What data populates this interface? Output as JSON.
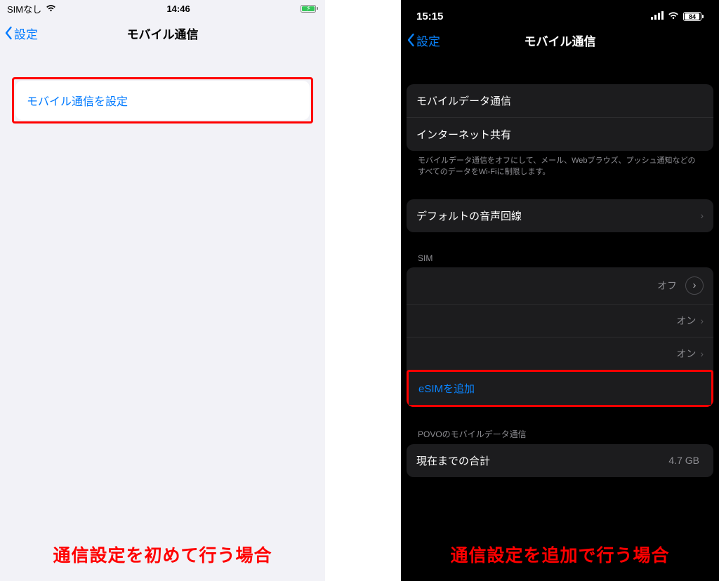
{
  "left": {
    "status": {
      "sim_text": "SIMなし",
      "time": "14:46"
    },
    "nav": {
      "back_label": "設定",
      "title": "モバイル通信"
    },
    "setup_row_label": "モバイル通信を設定",
    "caption": "通信設定を初めて行う場合"
  },
  "right": {
    "status": {
      "time": "15:15",
      "battery_pct": "84"
    },
    "nav": {
      "back_label": "設定",
      "title": "モバイル通信"
    },
    "group1": {
      "rows": [
        {
          "label": "モバイルデータ通信"
        },
        {
          "label": "インターネット共有"
        }
      ],
      "footer": "モバイルデータ通信をオフにして、メール、Webブラウズ、プッシュ通知などのすべてのデータをWi-Fiに制限します。"
    },
    "group2": {
      "rows": [
        {
          "label": "デフォルトの音声回線"
        }
      ]
    },
    "group_sim": {
      "header": "SIM",
      "rows": [
        {
          "label": "",
          "value": "オフ"
        },
        {
          "label": "",
          "value": "オン"
        },
        {
          "label": "",
          "value": "オン"
        }
      ],
      "add_label": "eSIMを追加"
    },
    "group_usage": {
      "header": "POVOのモバイルデータ通信",
      "rows": [
        {
          "label": "現在までの合計",
          "value": "4.7 GB"
        }
      ]
    },
    "caption": "通信設定を追加で行う場合"
  }
}
